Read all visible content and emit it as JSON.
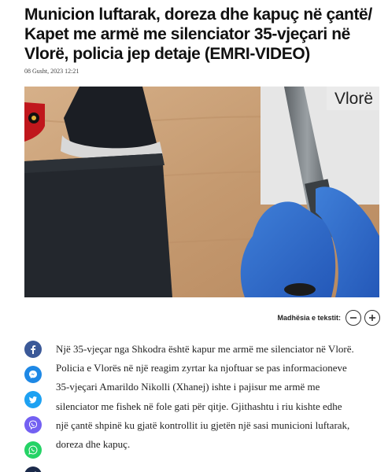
{
  "article": {
    "title": "Municion luftarak, doreza dhe kapuç në çantë/ Kapet me armë me silenciator 35-vjeçari në Vlorë, policia jep detaje (EMRI-VIDEO)",
    "date": "08 Gusht, 2023 12:21",
    "body": "Një 35-vjeçar nga Shkodra është kapur me armë me silenciator në Vlorë. Policia e Vlorës në një reagim zyrtar ka njoftuar se pas informacioneve 35-vjeçari Amarildo Nikolli (Xhanej) ishte i pajisur me armë me silenciator me fishek në fole gati për qitje. Gjithashtu i riu kishte edhe një çantë shpinë ku gjatë kontrollit iu gjetën një sasi municioni luftarak, doreza dhe kapuç."
  },
  "media": {
    "watermark": "Vlorë"
  },
  "text_size": {
    "label": "Madhësia e tekstit:",
    "decrease_icon": "minus-icon",
    "increase_icon": "plus-icon"
  },
  "share": {
    "items": [
      {
        "icon": "facebook-icon",
        "color": "#3b5998"
      },
      {
        "icon": "messenger-icon",
        "color": "#1e88e5"
      },
      {
        "icon": "twitter-icon",
        "color": "#1da1f2"
      },
      {
        "icon": "viber-icon",
        "color": "#7360f2"
      },
      {
        "icon": "whatsapp-icon",
        "color": "#25d366"
      },
      {
        "icon": "share-icon",
        "color": "#1b2a4a"
      }
    ]
  }
}
